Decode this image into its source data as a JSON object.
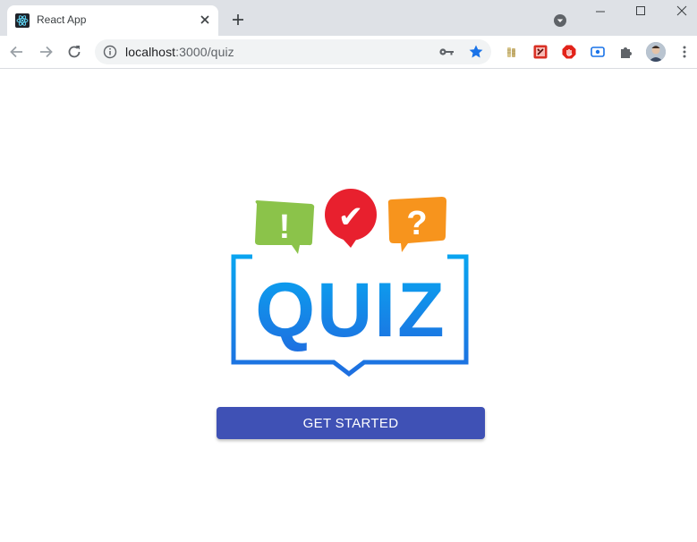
{
  "browser": {
    "tab": {
      "title": "React App",
      "favicon": "react-icon"
    },
    "url": {
      "host": "localhost",
      "path": ":3000/quiz"
    },
    "star_color": "#1a73e8"
  },
  "page": {
    "logo": {
      "bubbles": [
        "!",
        "✔",
        "?"
      ],
      "word": "QUIZ",
      "colors": {
        "green": "#8bc34a",
        "red": "#e8202e",
        "orange": "#f7941d",
        "blue": "#0aa4f0"
      }
    },
    "button": {
      "label": "GET STARTED",
      "color": "#3f51b5"
    }
  }
}
